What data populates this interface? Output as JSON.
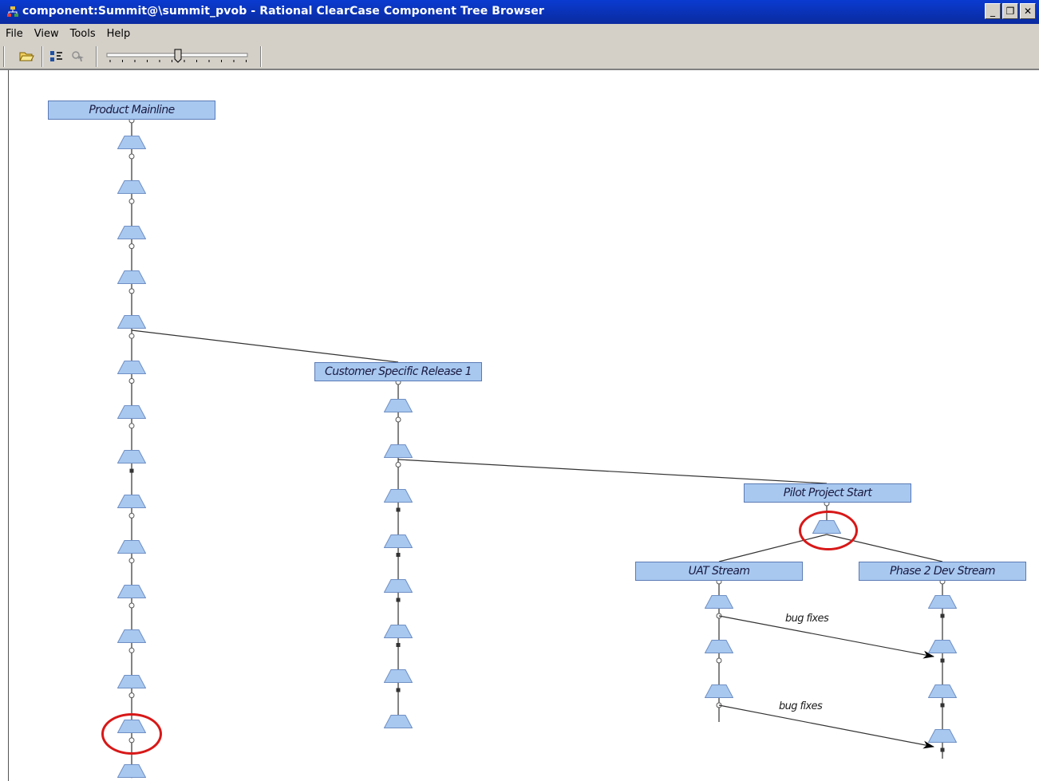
{
  "window": {
    "title": "component:Summit@\\summit_pvob - Rational ClearCase Component Tree Browser",
    "buttons": [
      "_",
      "❐",
      "✕"
    ]
  },
  "menu": [
    "File",
    "View",
    "Tools",
    "Help"
  ],
  "toolbar": {
    "buttons": [
      "open-icon",
      "tree-layout-icon",
      "pointer-icon"
    ],
    "zoom_level": 0.5
  },
  "streams": {
    "product_mainline": "Product Mainline",
    "customer_release": "Customer Specific Release 1",
    "pilot_project": "Pilot Project Start",
    "uat_stream": "UAT Stream",
    "phase2_stream": "Phase 2 Dev Stream"
  },
  "arrows": [
    {
      "label": "bug fixes"
    },
    {
      "label": "bug fixes"
    }
  ],
  "colors": {
    "stream_fill": "#a8c8f0",
    "baseline_fill": "#a8c8f0",
    "highlight": "#d81818"
  }
}
